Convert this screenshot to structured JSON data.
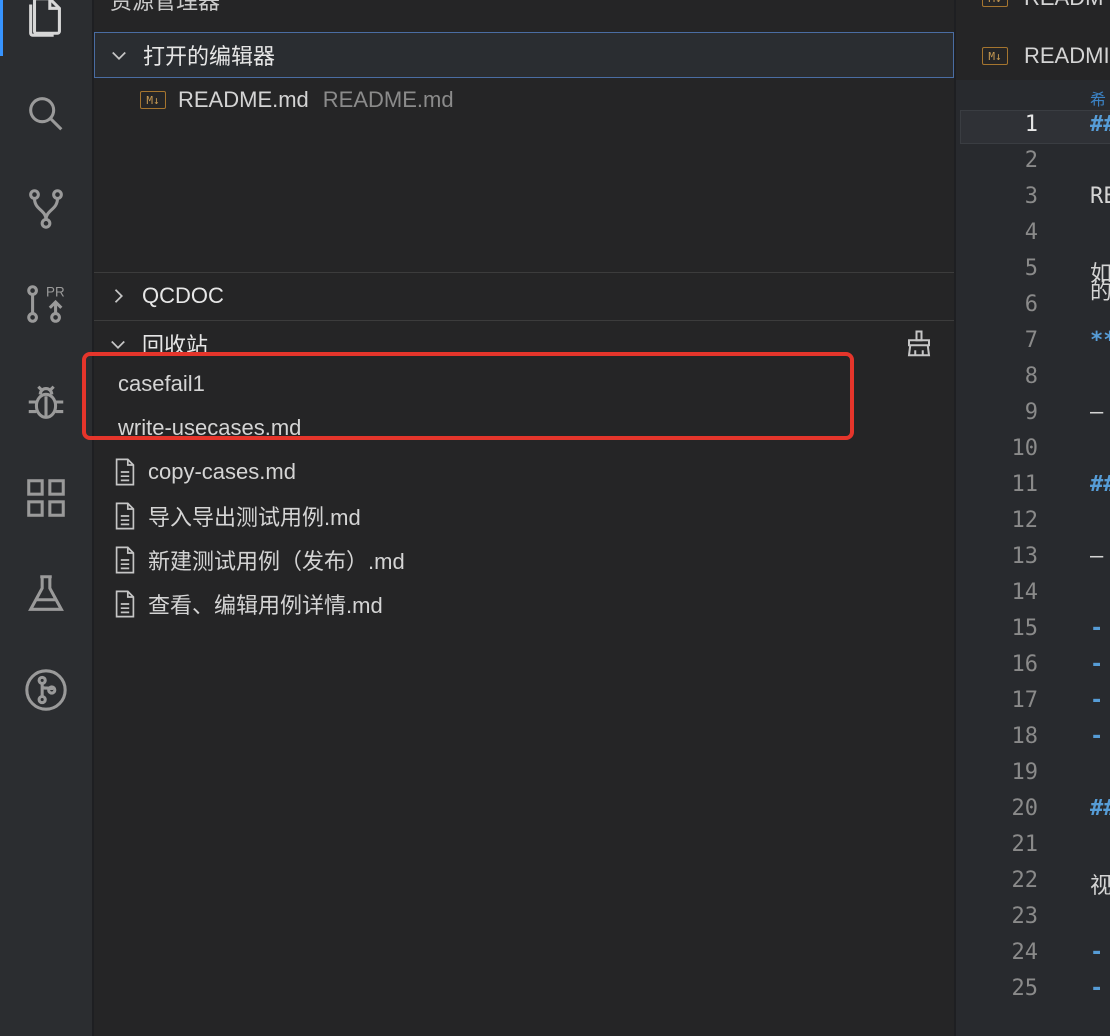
{
  "sidebar": {
    "title": "资源管理器",
    "open_editors": {
      "header": "打开的编辑器",
      "items": [
        {
          "name": "README.md",
          "description": "README.md",
          "badge": "M↓"
        }
      ]
    },
    "qcdoc": {
      "header": "QCDOC"
    },
    "recycle_bin": {
      "header": "回收站",
      "action_icon": "clear-all-icon",
      "items": [
        {
          "name": "casefail1"
        },
        {
          "name": "write-usecases.md"
        }
      ]
    },
    "files": [
      {
        "name": "copy-cases.md"
      },
      {
        "name": "导入导出测试用例.md"
      },
      {
        "name": "新建测试用例（发布）.md"
      },
      {
        "name": "查看、编辑用例详情.md"
      }
    ]
  },
  "activity_bar": {
    "icons": [
      "files-icon",
      "search-icon",
      "source-control-icon",
      "pull-request-icon",
      "debug-icon",
      "extensions-icon",
      "testing-icon",
      "git-graph-icon"
    ],
    "pr_label": "PR"
  },
  "editor": {
    "tabs": [
      {
        "label": "READM",
        "badge": "M↓"
      },
      {
        "label": "READMI",
        "badge": "M↓"
      }
    ],
    "breadcrumb": "希",
    "active_line": 1,
    "line_numbers": [
      1,
      2,
      3,
      4,
      5,
      6,
      7,
      8,
      9,
      10,
      11,
      12,
      13,
      14,
      15,
      16,
      17,
      18,
      19,
      20,
      21,
      22,
      23,
      24,
      25
    ],
    "snippets": [
      {
        "line": 1,
        "text": "##",
        "style": "blue"
      },
      {
        "line": 3,
        "text": "RE",
        "style": "plain"
      },
      {
        "line": 5,
        "text": "如",
        "style": "plain"
      },
      {
        "line": 5.5,
        "text": "的",
        "style": "plain"
      },
      {
        "line": 7,
        "text": "**",
        "style": "blue"
      },
      {
        "line": 9,
        "text": "—",
        "style": "plain"
      },
      {
        "line": 11,
        "text": "##",
        "style": "blue"
      },
      {
        "line": 13,
        "text": "—",
        "style": "plain"
      },
      {
        "line": 15,
        "text": "-",
        "style": "blue"
      },
      {
        "line": 16,
        "text": "-",
        "style": "blue"
      },
      {
        "line": 17,
        "text": "-",
        "style": "blue"
      },
      {
        "line": 18,
        "text": "-",
        "style": "blue"
      },
      {
        "line": 20,
        "text": "##",
        "style": "blue"
      },
      {
        "line": 22,
        "text": "视",
        "style": "plain"
      },
      {
        "line": 24,
        "text": "-",
        "style": "blue"
      },
      {
        "line": 25,
        "text": "-",
        "style": "blue"
      }
    ]
  },
  "colors": {
    "accent": "#3794ff",
    "highlight": "#e5352b",
    "markdown_badge": "#c69a53",
    "syntax_blue": "#569cd6"
  }
}
